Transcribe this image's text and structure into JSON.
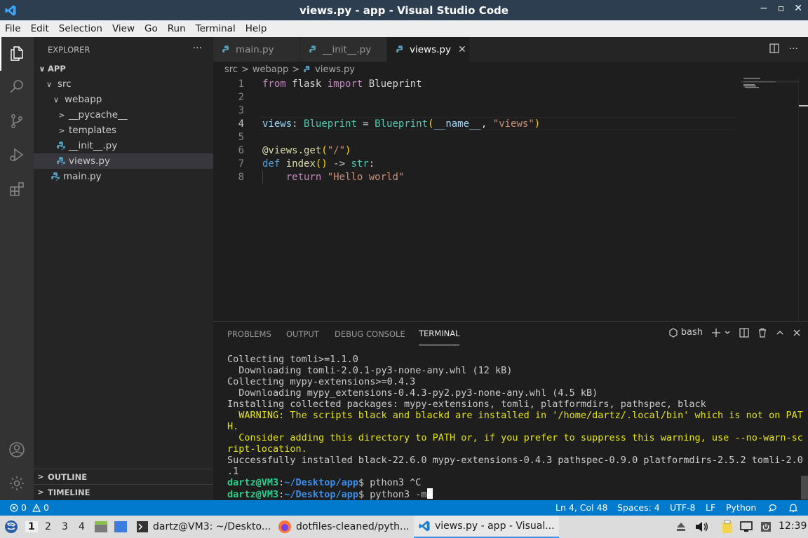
{
  "window": {
    "title": "views.py - app - Visual Studio Code",
    "controls": [
      "−",
      "▫",
      "✕"
    ]
  },
  "menu": [
    "File",
    "Edit",
    "Selection",
    "View",
    "Go",
    "Run",
    "Terminal",
    "Help"
  ],
  "sidebar": {
    "header": "EXPLORER",
    "more": "···",
    "tree": [
      {
        "label": "APP",
        "chevron": "∨"
      },
      {
        "label": "src",
        "chevron": "∨"
      },
      {
        "label": "webapp",
        "chevron": "∨"
      },
      {
        "label": "__pycache__",
        "chevron": ">"
      },
      {
        "label": "templates",
        "chevron": ">"
      },
      {
        "label": "__init__.py"
      },
      {
        "label": "views.py"
      },
      {
        "label": "main.py"
      }
    ],
    "outline": "OUTLINE",
    "timeline": "TIMELINE",
    "section_chevron": ">"
  },
  "tabs": [
    {
      "label": "main.py"
    },
    {
      "label": "__init__.py"
    },
    {
      "label": "views.py",
      "close": "✕"
    }
  ],
  "breadcrumb": {
    "parts": [
      "src",
      "webapp",
      "views.py"
    ],
    "sep": ">"
  },
  "editor": {
    "line_numbers": [
      "1",
      "2",
      "3",
      "4",
      "5",
      "6",
      "7",
      "8"
    ],
    "code": {
      "l1": {
        "kw1": "from",
        "mod": " flask ",
        "kw2": "import",
        "name": " Blueprint"
      },
      "l4": {
        "var": "views",
        "p1": ": ",
        "type": "Blueprint",
        "p2": " = ",
        "call": "Blueprint",
        "open": "(",
        "dunder": "__name__",
        "comma": ", ",
        "str": "\"views\"",
        "close": ")"
      },
      "l6": {
        "dec": "@views.get",
        "open": "(",
        "str": "\"/\"",
        "close": ")"
      },
      "l7": {
        "def": "def",
        "sp": " ",
        "fn": "index",
        "parens": "()",
        "arrow": " -> ",
        "type": "str",
        "colon": ":"
      },
      "l8": {
        "indent": "    ",
        "ret": "return",
        "sp": " ",
        "str": "\"Hello world\""
      }
    }
  },
  "panel": {
    "tabs": [
      "PROBLEMS",
      "OUTPUT",
      "DEBUG CONSOLE",
      "TERMINAL"
    ],
    "shell": "bash",
    "terminal_lines": [
      {
        "text": "Collecting tomli>=1.1.0",
        "warn": false
      },
      {
        "text": "  Downloading tomli-2.0.1-py3-none-any.whl (12 kB)",
        "warn": false
      },
      {
        "text": "Collecting mypy-extensions>=0.4.3",
        "warn": false
      },
      {
        "text": "  Downloading mypy_extensions-0.4.3-py2.py3-none-any.whl (4.5 kB)",
        "warn": false
      },
      {
        "text": "Installing collected packages: mypy-extensions, tomli, platformdirs, pathspec, black",
        "warn": false
      },
      {
        "text": "  WARNING: The scripts black and blackd are installed in '/home/dartz/.local/bin' which is not on PAT",
        "warn": true
      },
      {
        "text": "H.",
        "warn": true
      },
      {
        "text": "  Consider adding this directory to PATH or, if you prefer to suppress this warning, use --no-warn-sc",
        "warn": true
      },
      {
        "text": "ript-location.",
        "warn": true
      },
      {
        "text": "Successfully installed black-22.6.0 mypy-extensions-0.4.3 pathspec-0.9.0 platformdirs-2.5.2 tomli-2.0",
        "warn": false
      },
      {
        "text": ".1",
        "warn": false
      }
    ],
    "prompts": [
      {
        "user": "dartz@VM3",
        "colon": ":",
        "path": "~/Desktop/app",
        "dollar": "$ ",
        "cmd": "pthon3 ^C"
      },
      {
        "user": "dartz@VM3",
        "colon": ":",
        "path": "~/Desktop/app",
        "dollar": "$ ",
        "cmd": "python3 -m"
      }
    ]
  },
  "statusbar": {
    "errors": "0",
    "warnings": "0",
    "position": "Ln 4, Col 48",
    "spaces": "Spaces: 4",
    "encoding": "UTF-8",
    "eol": "LF",
    "language": "Python"
  },
  "taskbar": {
    "workspaces": [
      "1",
      "2",
      "3",
      "4"
    ],
    "apps": [
      {
        "label": "dartz@VM3: ~/Deskto..."
      },
      {
        "label": "dotfiles-cleaned/pyth..."
      },
      {
        "label": "views.py - app - Visual..."
      }
    ],
    "clock": "12:39"
  },
  "colors": {
    "accent": "#007acc",
    "titlebar": "#2c3e50",
    "editor_bg": "#1e1e1e",
    "sidebar_bg": "#252526"
  }
}
